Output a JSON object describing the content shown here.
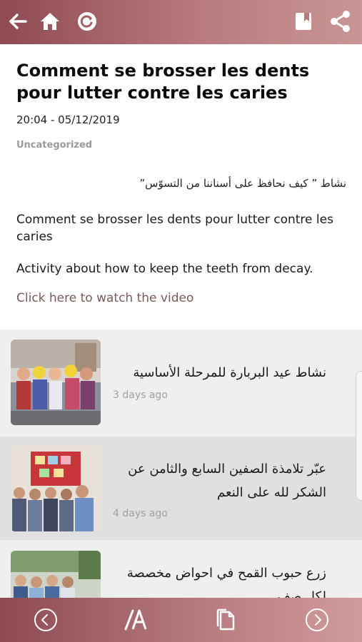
{
  "colors": {
    "bar_start": "#8f4a52",
    "bar_end": "#c99595",
    "link": "#7a5a5a",
    "muted": "#9a9a9a",
    "list_bg": "#efefef",
    "list_alt_bg": "#e0e0e0"
  },
  "topbar": {
    "icons": [
      "back-arrow-icon",
      "home-icon",
      "refresh-icon",
      "bookmark-icon",
      "share-icon"
    ]
  },
  "article": {
    "title": "Comment se brosser les dents pour lutter contre les caries",
    "date": "20:04 - 05/12/2019",
    "category": "Uncategorized",
    "arabic_line": "نشاط ” كيف نحافظ على أسناننا من التسوّس”",
    "para1": "Comment se brosser les dents pour lutter contre les caries",
    "para2": "Activity about how to keep the teeth from decay.",
    "link_text": "Click here to watch the video"
  },
  "related": [
    {
      "title": "نشاط عيد البربارة للمرحلة الأساسية",
      "ago": "3 days ago"
    },
    {
      "title": "عبّر تلامذة الصفين السابع والثامن عن الشكر لله على النعم",
      "ago": "4 days ago"
    },
    {
      "title": "زرع حبوب القمح في احواض مخصصة لكل صف",
      "ago": ""
    }
  ],
  "bottombar": {
    "icons": [
      "previous-circle-icon",
      "font-size-icon",
      "copy-document-icon",
      "next-circle-icon"
    ]
  }
}
